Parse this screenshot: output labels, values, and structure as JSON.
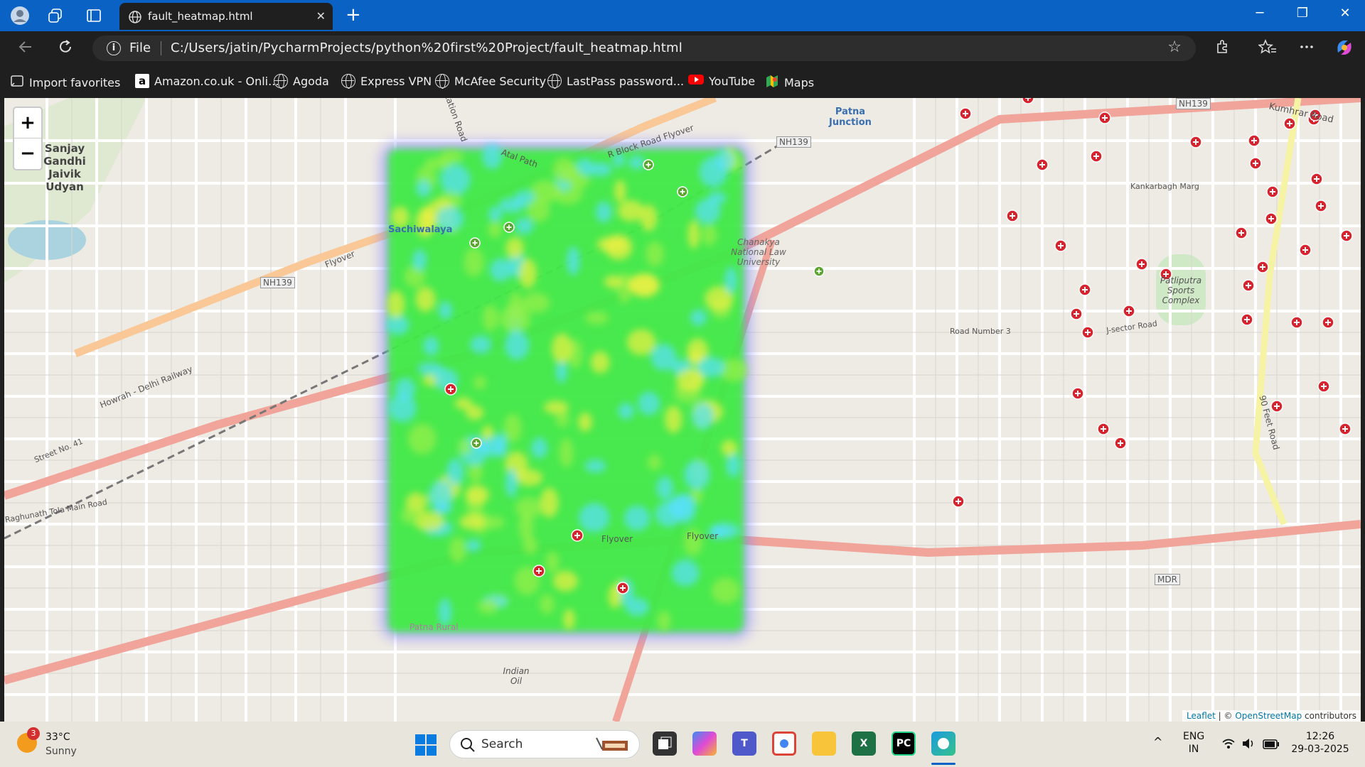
{
  "browser": {
    "tab_title": "fault_heatmap.html",
    "tab_close": "✕",
    "new_tab": "+",
    "minimize": "─",
    "restore": "❐",
    "close": "✕",
    "info_glyph": "i",
    "file_label": "File",
    "url": "C:/Users/jatin/PycharmProjects/python%20first%20Project/fault_heatmap.html",
    "star_glyph": "☆"
  },
  "bookmarks": [
    {
      "label": "Import favorites",
      "icon": "import-icon"
    },
    {
      "label": "Amazon.co.uk - Onli...",
      "icon": "amazon-icon"
    },
    {
      "label": "Agoda",
      "icon": "globe-icon"
    },
    {
      "label": "Express VPN",
      "icon": "globe-icon"
    },
    {
      "label": "McAfee Security",
      "icon": "globe-icon"
    },
    {
      "label": "LastPass password...",
      "icon": "globe-icon"
    },
    {
      "label": "YouTube",
      "icon": "youtube-icon"
    },
    {
      "label": "Maps",
      "icon": "maps-icon"
    }
  ],
  "map": {
    "zoom_in": "+",
    "zoom_out": "−",
    "attribution_leaflet": "Leaflet",
    "attribution_sep": " | © ",
    "attribution_osm": "OpenStreetMap",
    "attribution_tail": " contributors",
    "labels": {
      "sanjay": "Sanjay Gandhi Jaivik Udyan",
      "sachiwalaya": "Sachiwalaya",
      "patna_junction": "Patna Junction",
      "nh139_a": "NH139",
      "nh139_b": "NH139",
      "nh139_c": "NH139",
      "kumhrar": "Kumhrar Road",
      "kankarbagh": "Kankarbagh Marg",
      "patliputra": "Patliputra Sports Complex",
      "road3": "Road Number 3",
      "jsector": "J-sector Road",
      "mdr": "MDR",
      "road41": "Street No. 41",
      "raghunath": "Raghunath Tola Main Road",
      "patna_rural": "Patna Rural",
      "indian_oil": "Indian Oil",
      "flyover1": "Flyover",
      "flyover2": "Flyover",
      "flyover3": "Flyover",
      "atal": "Atal Path",
      "rblock": "R Block Road Flyover",
      "station": "Station Road",
      "howrah": "Howrah - Delhi Railway",
      "chanakya": "Chanakya National Law University",
      "feet90": "90 Feet Road"
    },
    "heatmap_colors": [
      "#3cf03c",
      "#9af04a",
      "#f0f044",
      "#58e0ff",
      "#7070ff"
    ],
    "red_marker_color": "#d7232d",
    "green_marker_color": "#5aa52f"
  },
  "taskbar": {
    "weather_badge": "3",
    "temperature": "33°C",
    "condition": "Sunny",
    "search_placeholder": "Search",
    "language_top": "ENG",
    "language_bottom": "IN",
    "time": "12:26",
    "date": "29-03-2025",
    "chevron": "^"
  }
}
